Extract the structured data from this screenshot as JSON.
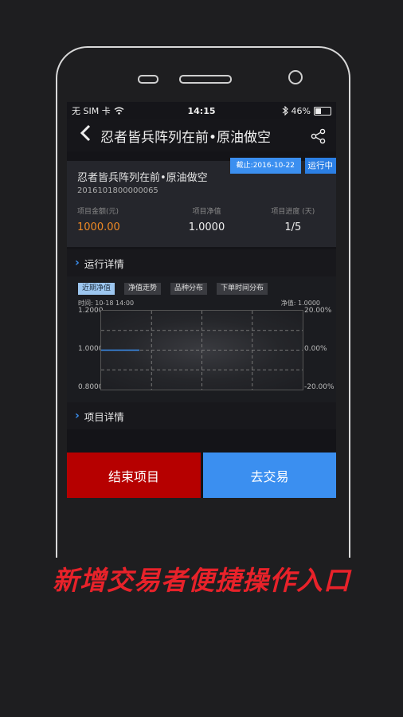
{
  "status_bar": {
    "carrier": "无 SIM 卡",
    "time": "14:15",
    "battery_percent": 46,
    "battery_label": "46%"
  },
  "nav": {
    "title": "忍者皆兵阵列在前•原油做空"
  },
  "project": {
    "name": "忍者皆兵阵列在前•原油做空",
    "code": "2016101800000065",
    "date_badge": "截止:2016-10-22",
    "status_badge": "运行中",
    "metrics": [
      {
        "label": "项目金额(元)",
        "value": "1000.00",
        "color": "#f08a24"
      },
      {
        "label": "项目净值",
        "value": "1.0000",
        "color": "#eeeeee"
      },
      {
        "label": "项目进度 (天)",
        "value": "1/5",
        "color": "#eeeeee"
      }
    ]
  },
  "sections": {
    "run_details": "运行详情",
    "project_details": "项目详情"
  },
  "chart_tabs": [
    "近期净值",
    "净值走势",
    "品种分布",
    "下单时间分布"
  ],
  "chart_info": {
    "time_label": "时间:  10-18 14:00",
    "nav_label": "净值:  1.0000"
  },
  "chart_data": {
    "type": "line",
    "x": [
      "10-18 14:00"
    ],
    "series": [
      {
        "values": [
          1.0
        ]
      }
    ],
    "ylim": [
      0.8,
      1.2
    ],
    "y_ticks_left": [
      "1.2000",
      "1.0000",
      "0.8000"
    ],
    "y_ticks_right": [
      "20.00%",
      "0.00%",
      "-20.00%"
    ],
    "grid": true
  },
  "buttons": {
    "end": "结束项目",
    "trade": "去交易"
  },
  "caption": "新增交易者便捷操作入口",
  "colors": {
    "accent": "#3b8ff0",
    "danger": "#b60000",
    "caption": "#e8222a"
  }
}
